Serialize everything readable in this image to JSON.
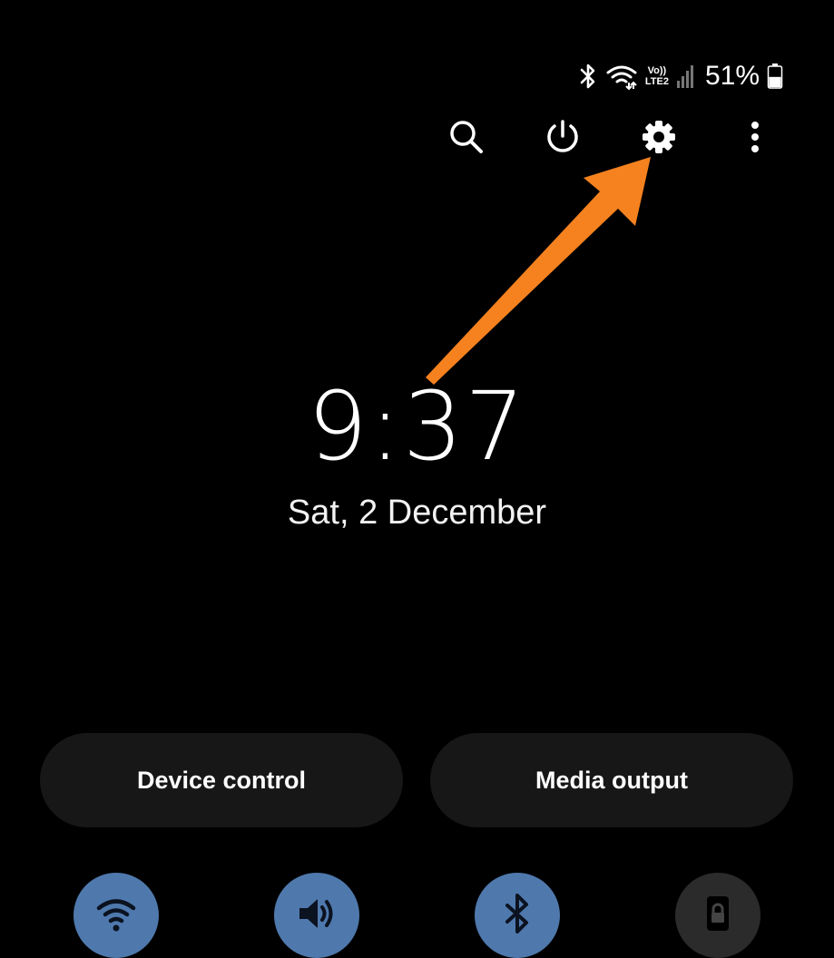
{
  "status_bar": {
    "icons": [
      "bluetooth-icon",
      "wifi-icon",
      "volte-icon",
      "signal-icon",
      "battery-icon"
    ],
    "volte_top": "Vo))",
    "volte_bottom": "LTE2",
    "battery_percent": "51%",
    "battery_level": 0.51
  },
  "actions": [
    {
      "name": "search-icon",
      "label": "Search"
    },
    {
      "name": "power-icon",
      "label": "Power"
    },
    {
      "name": "gear-icon",
      "label": "Settings"
    },
    {
      "name": "more-options-icon",
      "label": "More options"
    }
  ],
  "clock": {
    "time": "9:37",
    "date": "Sat, 2 December"
  },
  "buttons": {
    "device_control": "Device control",
    "media_output": "Media output"
  },
  "toggles": [
    {
      "name": "wifi-toggle",
      "icon": "wifi-icon",
      "state": "on"
    },
    {
      "name": "sound-toggle",
      "icon": "speaker-icon",
      "state": "on"
    },
    {
      "name": "bluetooth-toggle",
      "icon": "bluetooth-icon",
      "state": "on"
    },
    {
      "name": "screen-lock-toggle",
      "icon": "lock-icon",
      "state": "off"
    }
  ],
  "colors": {
    "background": "#000000",
    "toggle_active": "#4f79ad",
    "toggle_inactive": "#2b2b2b",
    "pill": "#171717",
    "annotation_arrow": "#f5821f"
  }
}
